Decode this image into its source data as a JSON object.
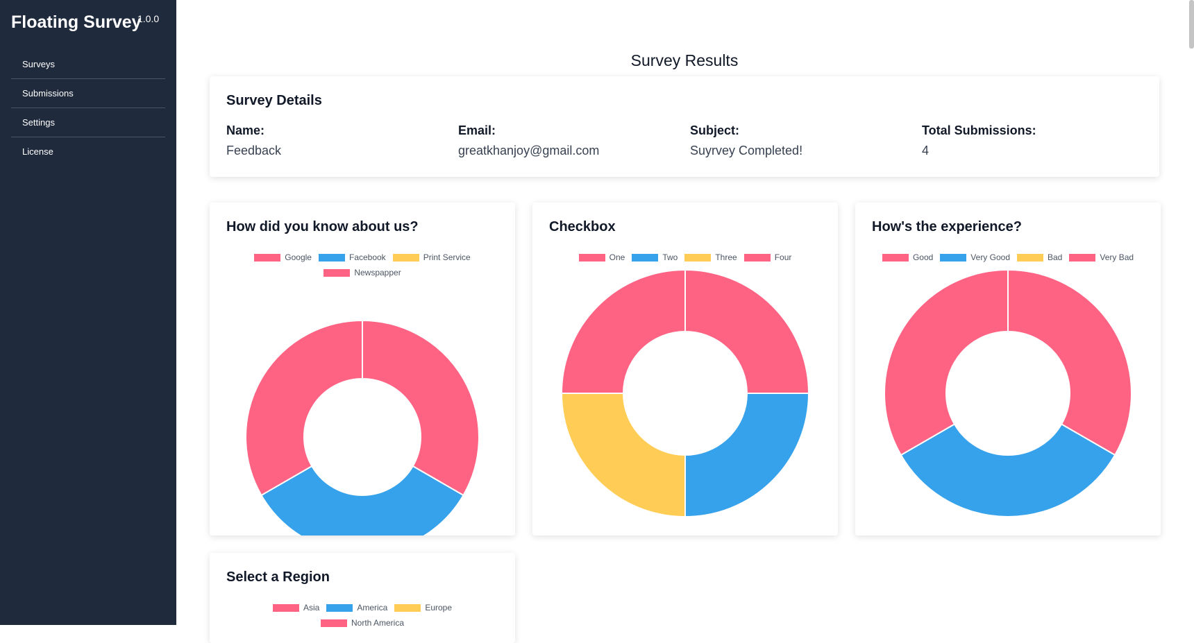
{
  "app": {
    "title": "Floating Survey",
    "version": "1.0.0"
  },
  "sidebar": {
    "items": [
      {
        "label": "Surveys"
      },
      {
        "label": "Submissions"
      },
      {
        "label": "Settings"
      },
      {
        "label": "License"
      }
    ]
  },
  "page": {
    "title": "Survey Results"
  },
  "details": {
    "heading": "Survey Details",
    "name_label": "Name:",
    "name_value": "Feedback",
    "email_label": "Email:",
    "email_value": "greatkhanjoy@gmail.com",
    "subject_label": "Subject:",
    "subject_value": "Suyrvey Completed!",
    "total_label": "Total Submissions:",
    "total_value": "4"
  },
  "colors": {
    "pink": "#ff6384",
    "blue": "#36a2eb",
    "yellow": "#ffcd56",
    "sidebar_bg": "#1f2a3c"
  },
  "chart_data": [
    {
      "type": "doughnut",
      "title": "How did you know about us?",
      "categories": [
        "Google",
        "Facebook",
        "Print Service",
        "Newspapper"
      ],
      "values": [
        1,
        1,
        0,
        1
      ],
      "colors": [
        "#ff6384",
        "#36a2eb",
        "#ffcd56",
        "#ff6384"
      ],
      "legend": "top"
    },
    {
      "type": "doughnut",
      "title": "Checkbox",
      "categories": [
        "One",
        "Two",
        "Three",
        "Four"
      ],
      "values": [
        1,
        1,
        1,
        1
      ],
      "colors": [
        "#ff6384",
        "#36a2eb",
        "#ffcd56",
        "#ff6384"
      ],
      "legend": "top"
    },
    {
      "type": "doughnut",
      "title": "How's the experience?",
      "categories": [
        "Good",
        "Very Good",
        "Bad",
        "Very Bad"
      ],
      "values": [
        1,
        1,
        0,
        1
      ],
      "colors": [
        "#ff6384",
        "#36a2eb",
        "#ffcd56",
        "#ff6384"
      ],
      "legend": "top"
    },
    {
      "type": "doughnut",
      "title": "Select a Region",
      "categories": [
        "Asia",
        "America",
        "Europe",
        "North America"
      ],
      "values": [],
      "colors": [
        "#ff6384",
        "#36a2eb",
        "#ffcd56",
        "#ff6384"
      ],
      "legend": "top"
    }
  ]
}
